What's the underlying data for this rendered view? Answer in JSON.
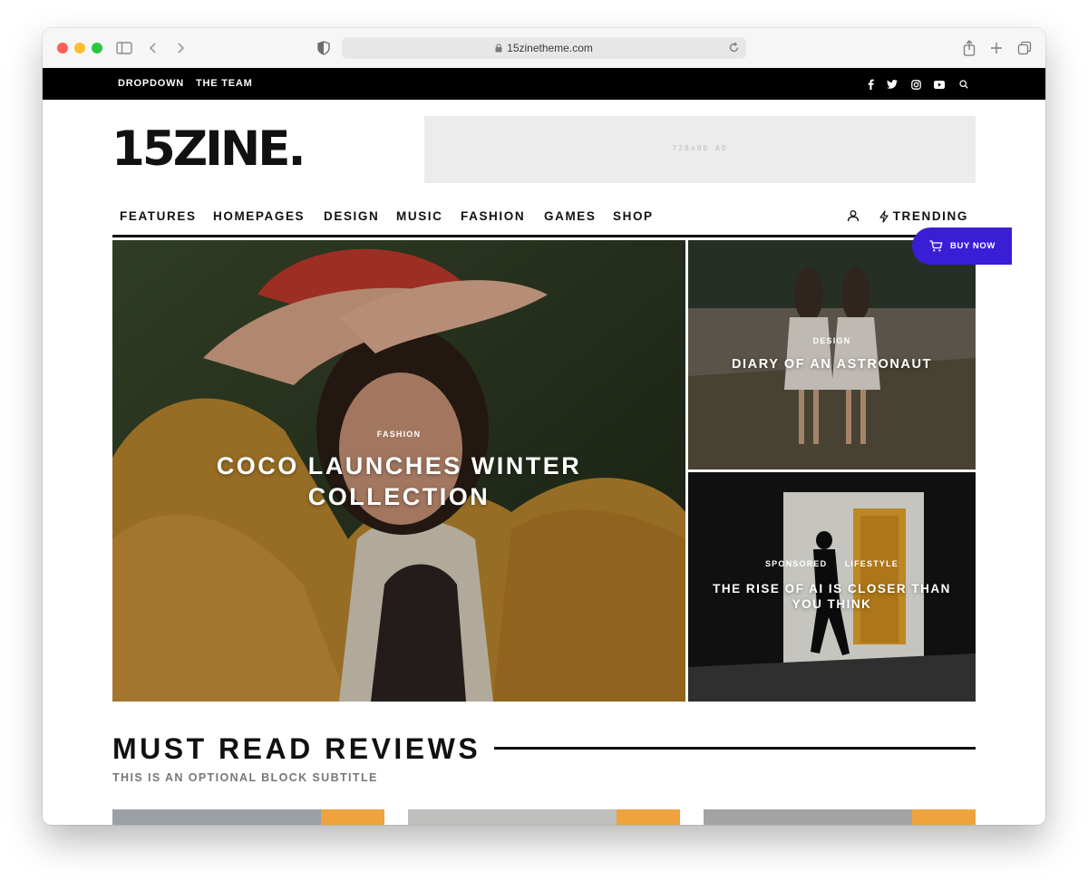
{
  "browser": {
    "url": "15zinetheme.com",
    "dots": [
      "#ff5f57",
      "#febc2e",
      "#28c840"
    ]
  },
  "topbar": {
    "links": [
      "DROPDOWN",
      "THE TEAM"
    ],
    "social_icons": [
      "facebook-icon",
      "twitter-icon",
      "instagram-icon",
      "youtube-icon",
      "search-icon"
    ]
  },
  "header": {
    "logo": "15ZINE.",
    "ad_label": "728x90 AD"
  },
  "nav": {
    "items": [
      "FEATURES",
      "HOMEPAGES",
      "DESIGN",
      "MUSIC",
      "FASHION",
      "GAMES",
      "SHOP"
    ],
    "trending": "TRENDING"
  },
  "hero": {
    "main": {
      "category": "FASHION",
      "title_line1": "COCO LAUNCHES WINTER",
      "title_line2": "COLLECTION"
    },
    "top_right": {
      "category": "DESIGN",
      "title": "DIARY OF AN ASTRONAUT"
    },
    "bottom_right": {
      "category1": "SPONSORED",
      "category2": "LIFESTYLE",
      "title_line1": "THE RISE OF AI IS CLOSER THAN",
      "title_line2": "YOU THINK"
    }
  },
  "buy_now": "BUY NOW",
  "reviews": {
    "title": "MUST READ REVIEWS",
    "subtitle": "THIS IS AN OPTIONAL BLOCK SUBTITLE"
  },
  "colors": {
    "accent": "#3a1ed6",
    "badge": "#f0a23c",
    "topbar": "#000000"
  }
}
